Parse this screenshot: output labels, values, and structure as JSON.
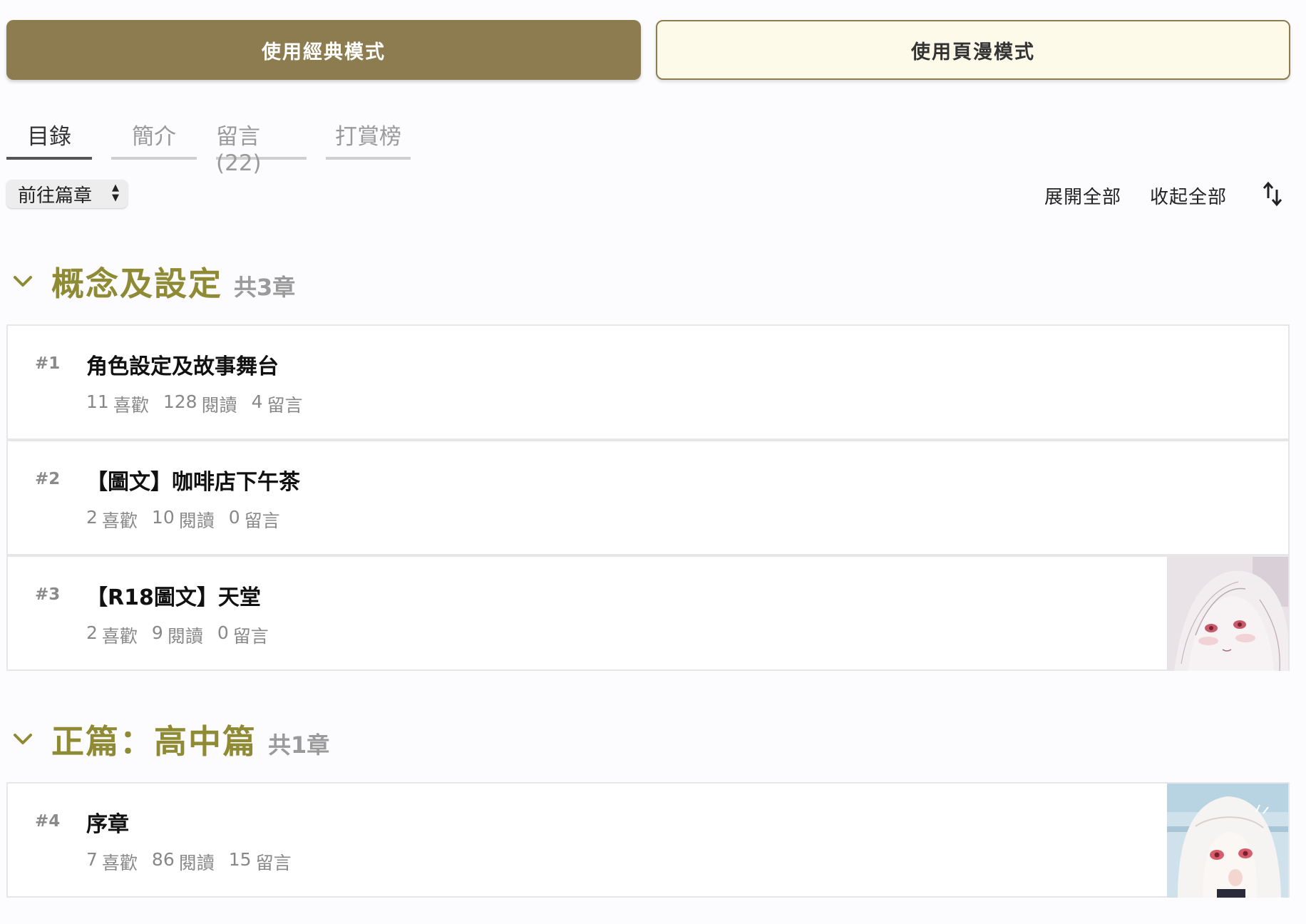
{
  "modes": {
    "classic_label": "使用經典模式",
    "manga_label": "使用頁漫模式"
  },
  "tabs": [
    {
      "label": "目錄",
      "active": true
    },
    {
      "label": "簡介",
      "active": false
    },
    {
      "label": "留言 (22)",
      "active": false
    },
    {
      "label": "打賞榜",
      "active": false
    }
  ],
  "controls": {
    "goto_label": "前往篇章",
    "expand_all": "展開全部",
    "collapse_all": "收起全部"
  },
  "sections": [
    {
      "title": "概念及設定",
      "count": "共3章",
      "chapters": [
        {
          "num": "#1",
          "title": "角色設定及故事舞台",
          "likes": "11",
          "likes_label": "喜歡",
          "reads": "128",
          "reads_label": "閱讀",
          "comments": "4",
          "comments_label": "留言"
        },
        {
          "num": "#2",
          "title": "【圖文】咖啡店下午茶",
          "likes": "2",
          "likes_label": "喜歡",
          "reads": "10",
          "reads_label": "閱讀",
          "comments": "0",
          "comments_label": "留言"
        },
        {
          "num": "#3",
          "title": "【R18圖文】天堂",
          "likes": "2",
          "likes_label": "喜歡",
          "reads": "9",
          "reads_label": "閱讀",
          "comments": "0",
          "comments_label": "留言"
        }
      ]
    },
    {
      "title": "正篇：高中篇",
      "count": "共1章",
      "chapters": [
        {
          "num": "#4",
          "title": "序章",
          "likes": "7",
          "likes_label": "喜歡",
          "reads": "86",
          "reads_label": "閱讀",
          "comments": "15",
          "comments_label": "留言"
        }
      ]
    }
  ],
  "colors": {
    "accent": "#8c7c50",
    "section_title": "#8f8a34",
    "manga_bg": "#fefae9"
  }
}
